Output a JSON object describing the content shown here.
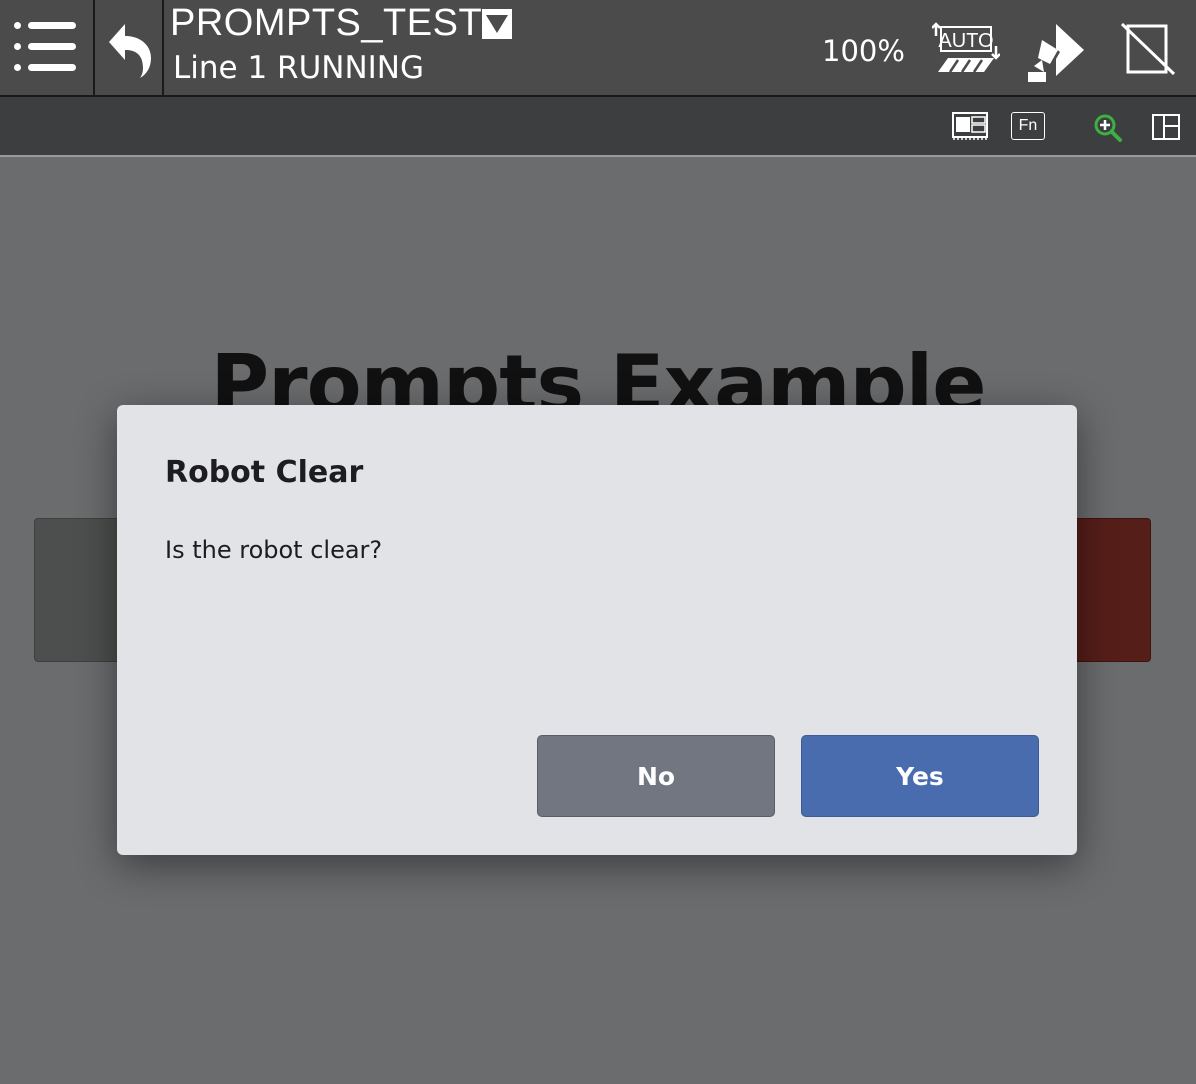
{
  "header": {
    "program_name": "PROMPTS_TEST",
    "status": "Line 1 RUNNING",
    "override": "100%",
    "mode_label": "AUTO"
  },
  "toolbar": {
    "fn_label": "Fn"
  },
  "background": {
    "title": "Prompts Example"
  },
  "dialog": {
    "title": "Robot Clear",
    "message": "Is the robot clear?",
    "no_label": "No",
    "yes_label": "Yes"
  },
  "colors": {
    "topbar": "#4b4b4b",
    "toolbar": "#3d3e3f",
    "overlay_background": "#6b6c6e",
    "dialog_background": "#e2e3e7",
    "no_button": "#727680",
    "yes_button": "#496cae",
    "zoom_icon": "#3cb043"
  },
  "icons": {
    "menu": "menu-list-icon",
    "back": "undo-arrow-icon",
    "auto_mode": "auto-mode-icon",
    "run": "robot-run-icon",
    "no_teach_pendant": "tablet-disabled-icon",
    "layout": "screen-layout-icon",
    "fn": "fn-key-icon",
    "zoom": "zoom-in-icon",
    "split": "split-view-icon"
  }
}
